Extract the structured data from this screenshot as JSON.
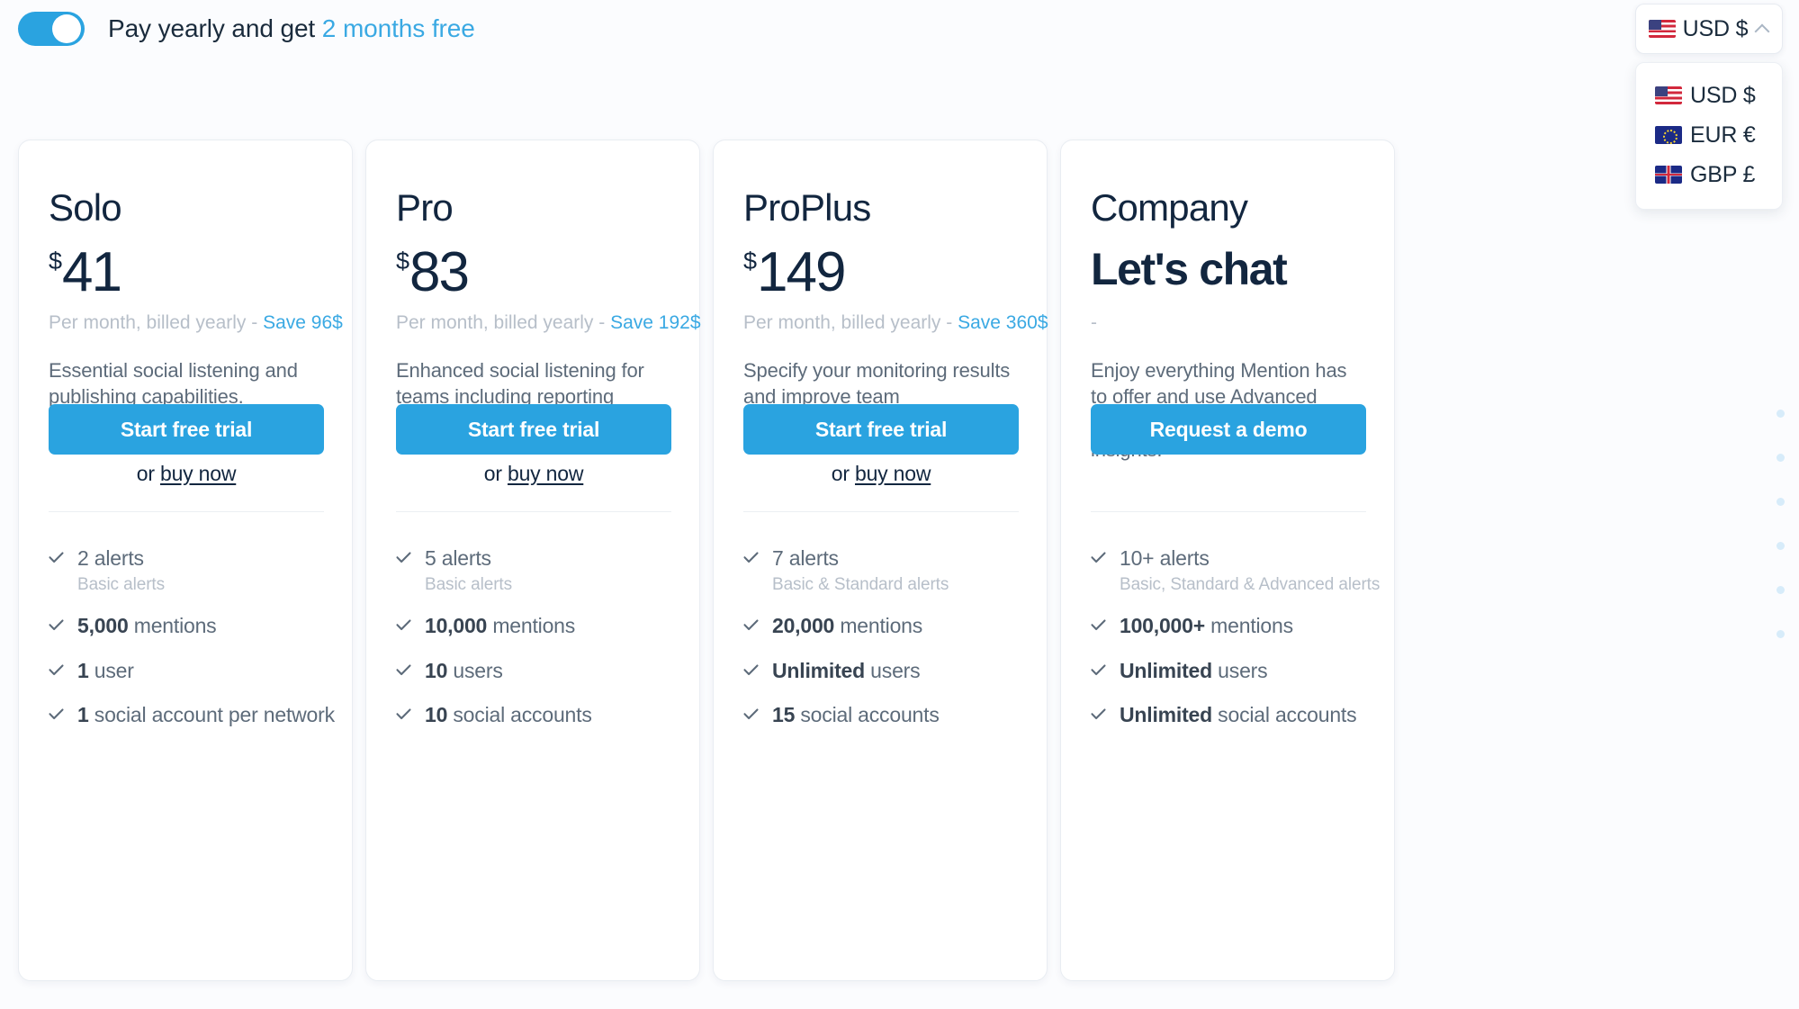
{
  "header": {
    "toggle": {
      "name": "yearly-billing-toggle",
      "state": "on",
      "label_prefix": "Pay yearly and get ",
      "label_highlight": "2 months free"
    },
    "currency_selector": {
      "selected": "USD $",
      "selected_flag": "us-flag-icon",
      "caret_icon": "chevron-up-icon",
      "expanded": true,
      "options": [
        {
          "label": "USD $",
          "flag": "us-flag-icon",
          "flag_class": "flag-us"
        },
        {
          "label": "EUR €",
          "flag": "eu-flag-icon",
          "flag_class": "flag-eu"
        },
        {
          "label": "GBP £",
          "flag": "gb-flag-icon",
          "flag_class": "flag-gb"
        }
      ]
    }
  },
  "colors": {
    "accent_blue": "#2aa3e0",
    "link_blue": "#3aa9e3",
    "navy": "#12263f",
    "body_gray": "#5d6b7a",
    "muted_gray": "#b7bfc9",
    "page_background": "#fbfcfe",
    "card_background": "#ffffff",
    "card_border": "#e9edf2",
    "divider": "#eceff3",
    "dot_rail": "#d7ecfa"
  },
  "plans": [
    {
      "name": "Solo",
      "currency_symbol": "$",
      "price": "41",
      "price_is_text": false,
      "billing_prefix": "Per month, billed yearly - ",
      "billing_save": "Save 96$",
      "description": "Essential social listening and publishing capabilities.",
      "cta_label": "Start free trial",
      "secondary_prefix": "or ",
      "secondary_link": "buy now",
      "features": [
        {
          "bold": "",
          "text": "2 alerts",
          "sub": "Basic alerts"
        },
        {
          "bold": "5,000",
          "text": " mentions",
          "sub": ""
        },
        {
          "bold": "1",
          "text": " user",
          "sub": ""
        },
        {
          "bold": "1",
          "text": " social account per network",
          "sub": ""
        }
      ]
    },
    {
      "name": "Pro",
      "currency_symbol": "$",
      "price": "83",
      "price_is_text": false,
      "billing_prefix": "Per month, billed yearly - ",
      "billing_save": "Save 192$",
      "description": "Enhanced social listening for teams including reporting features.",
      "cta_label": "Start free trial",
      "secondary_prefix": "or ",
      "secondary_link": "buy now",
      "features": [
        {
          "bold": "",
          "text": "5 alerts",
          "sub": "Basic alerts"
        },
        {
          "bold": "10,000",
          "text": " mentions",
          "sub": ""
        },
        {
          "bold": "10",
          "text": " users",
          "sub": ""
        },
        {
          "bold": "10",
          "text": " social accounts",
          "sub": ""
        }
      ]
    },
    {
      "name": "ProPlus",
      "currency_symbol": "$",
      "price": "149",
      "price_is_text": false,
      "billing_prefix": "Per month, billed yearly - ",
      "billing_save": "Save 360$",
      "description": "Specify your monitoring results and improve team collaboration.",
      "cta_label": "Start free trial",
      "secondary_prefix": "or ",
      "secondary_link": "buy now",
      "features": [
        {
          "bold": "",
          "text": "7 alerts",
          "sub": "Basic & Standard alerts"
        },
        {
          "bold": "20,000",
          "text": " mentions",
          "sub": ""
        },
        {
          "bold": "Unlimited",
          "text": " users",
          "sub": ""
        },
        {
          "bold": "15",
          "text": " social accounts",
          "sub": ""
        }
      ]
    },
    {
      "name": "Company",
      "currency_symbol": "",
      "price": "Let's chat",
      "price_is_text": true,
      "billing_prefix": "-",
      "billing_save": "",
      "description": "Enjoy everything Mention has to offer and use Advanced Alerts for the most precise insights.",
      "cta_label": "Request a demo",
      "secondary_prefix": "",
      "secondary_link": "",
      "features": [
        {
          "bold": "",
          "text": "10+ alerts",
          "sub": "Basic, Standard & Advanced alerts"
        },
        {
          "bold": "100,000+",
          "text": " mentions",
          "sub": ""
        },
        {
          "bold": "Unlimited",
          "text": " users",
          "sub": ""
        },
        {
          "bold": "Unlimited",
          "text": " social accounts",
          "sub": ""
        }
      ]
    }
  ],
  "decoration": {
    "dot_rail_count": 6
  }
}
